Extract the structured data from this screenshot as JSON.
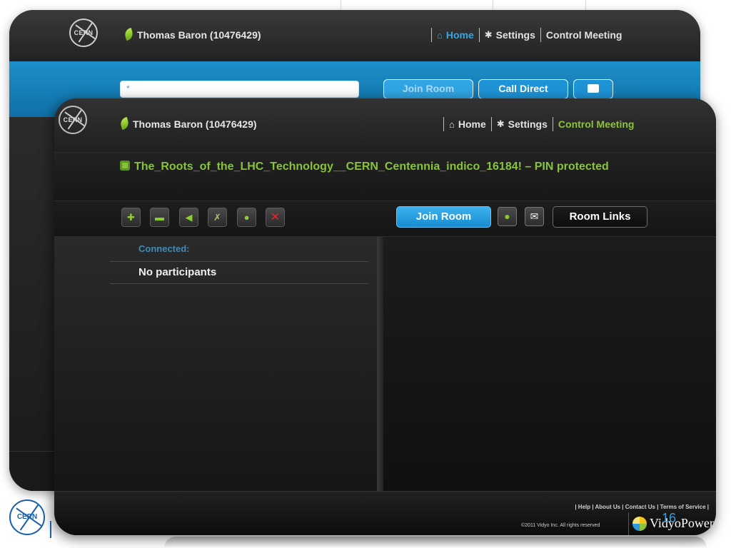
{
  "back_window": {
    "user": "Thomas Baron (10476429)",
    "nav": {
      "home": "Home",
      "settings": "Settings",
      "control_meeting": "Control Meeting"
    },
    "search": {
      "value": "*"
    },
    "buttons": {
      "join_room": "Join Room",
      "call_direct": "Call Direct"
    }
  },
  "front_window": {
    "user": "Thomas Baron (10476429)",
    "nav": {
      "home": "Home",
      "settings": "Settings",
      "control_meeting": "Control Meeting"
    },
    "room_title": "The_Roots_of_the_LHC_Technology__CERN_Centennia_indico_16184! – PIN protected",
    "toolbar": {
      "join_room": "Join Room",
      "room_links": "Room Links"
    },
    "participants": {
      "connected_label": "Connected:",
      "empty_text": "No participants"
    },
    "footer": {
      "links": "| Help | About Us | Contact Us | Terms of Service |",
      "copyright": "©2011 Vidyo Inc. All rights reserved",
      "brand": "VidyoPower"
    }
  },
  "logo_text": "CERN",
  "slide_number": "16",
  "colors": {
    "accent_green": "#87c43a",
    "accent_blue": "#1e94d6",
    "dark_bg": "#151515",
    "danger": "#e32626"
  }
}
